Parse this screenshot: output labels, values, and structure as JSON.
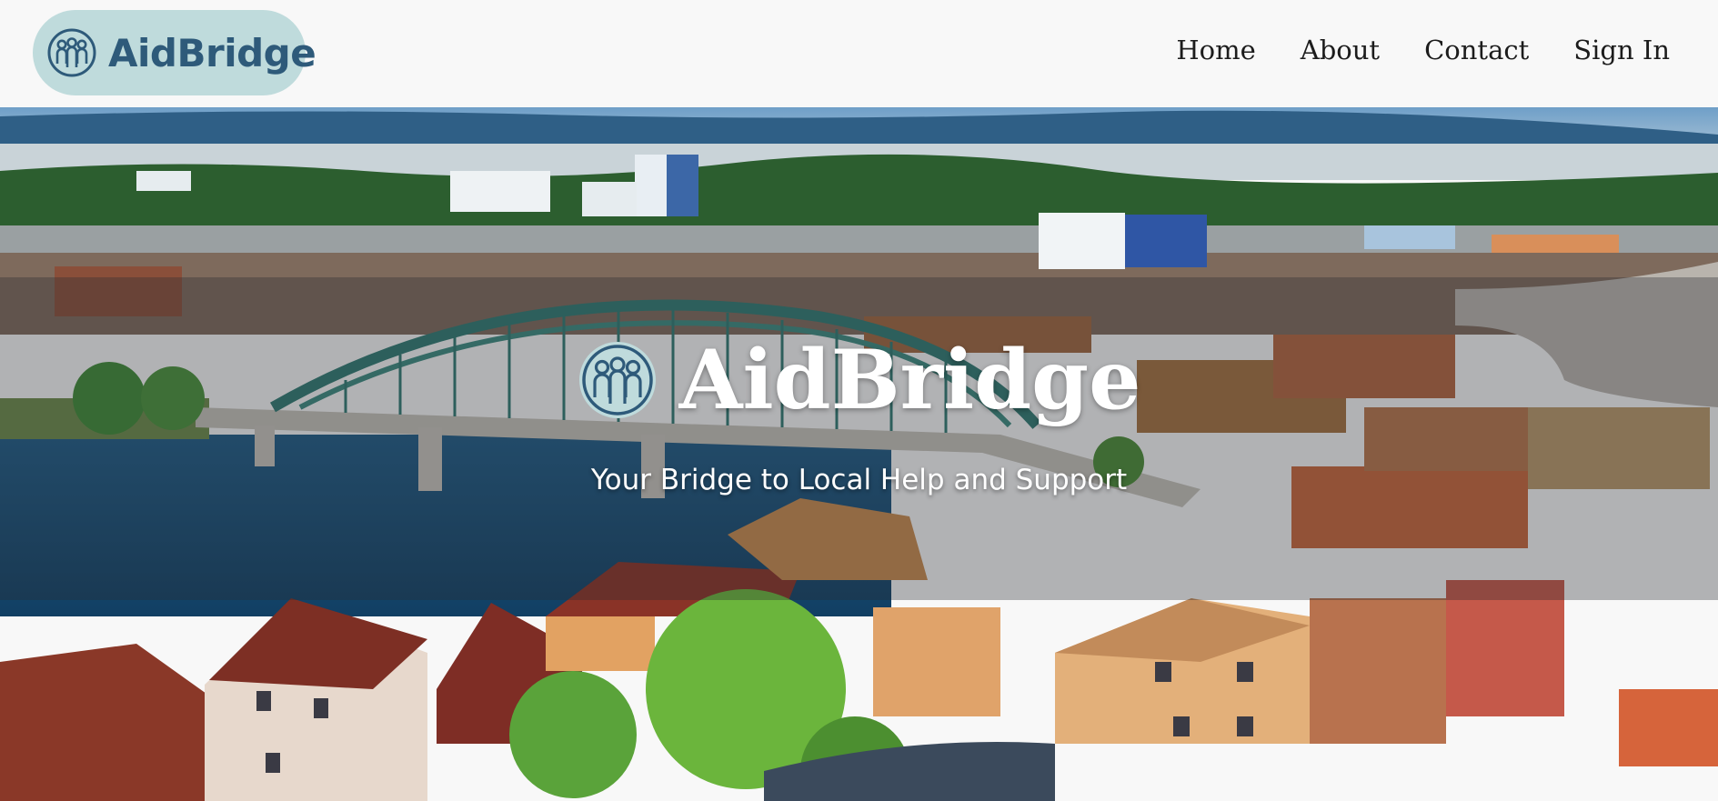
{
  "brand": {
    "name": "AidBridge",
    "icon": "people-group-icon",
    "pill_color": "#bfdbdc",
    "text_color": "#2e5a7a"
  },
  "nav": {
    "items": [
      {
        "label": "Home"
      },
      {
        "label": "About"
      },
      {
        "label": "Contact"
      },
      {
        "label": "Sign In"
      }
    ]
  },
  "hero": {
    "title": "AidBridge",
    "subtitle": "Your Bridge to Local Help and Support",
    "icon": "people-group-icon",
    "background": "city-bridge-aerial-photo"
  }
}
